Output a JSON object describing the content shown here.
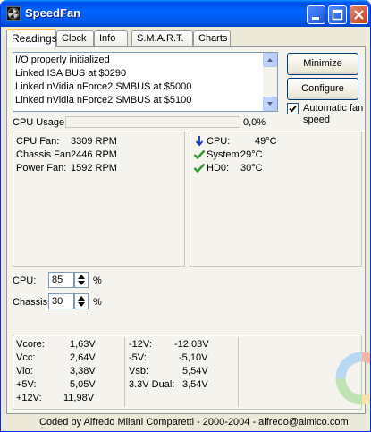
{
  "window": {
    "title": "SpeedFan"
  },
  "tabs": [
    {
      "label": "Readings",
      "active": true
    },
    {
      "label": "Clock",
      "active": false
    },
    {
      "label": "Info",
      "active": false
    },
    {
      "label": "S.M.A.R.T.",
      "active": false
    },
    {
      "label": "Charts",
      "active": false
    }
  ],
  "log": {
    "lines": [
      "I/O properly initialized",
      "Linked ISA BUS at $0290",
      "Linked nVidia nForce2 SMBUS at $5000",
      "Linked nVidia nForce2 SMBUS at $5100"
    ]
  },
  "buttons": {
    "minimize": "Minimize",
    "configure": "Configure"
  },
  "auto_fan": {
    "label": "Automatic fan speed",
    "checked": true
  },
  "cpu_usage": {
    "label": "CPU Usage",
    "value": "0,0%",
    "fraction": 0.0
  },
  "fans": [
    {
      "label": "CPU Fan:",
      "value": "3309 RPM"
    },
    {
      "label": "Chassis Fan:",
      "value": "2446 RPM"
    },
    {
      "label": "Power Fan:",
      "value": "1592 RPM"
    }
  ],
  "temps": [
    {
      "label": "CPU:",
      "value": "49°C",
      "icon": "arrow-down-icon"
    },
    {
      "label": "System:",
      "value": "29°C",
      "icon": "checkmark-icon"
    },
    {
      "label": "HD0:",
      "value": "30°C",
      "icon": "checkmark-icon"
    }
  ],
  "speeds": [
    {
      "label": "CPU:",
      "value": "85",
      "unit": "%"
    },
    {
      "label": "Chassis:",
      "value": "30",
      "unit": "%"
    }
  ],
  "voltages_left": [
    {
      "label": "Vcore:",
      "value": "1,63V"
    },
    {
      "label": "Vcc:",
      "value": "2,64V"
    },
    {
      "label": "Vio:",
      "value": "3,38V"
    },
    {
      "label": "+5V:",
      "value": "5,05V"
    },
    {
      "label": "+12V:",
      "value": "11,98V"
    }
  ],
  "voltages_right": [
    {
      "label": "-12V:",
      "value": "-12,03V"
    },
    {
      "label": "-5V:",
      "value": "-5,10V"
    },
    {
      "label": "Vsb:",
      "value": "5,54V"
    },
    {
      "label": "3.3V Dual:",
      "value": "3,54V"
    }
  ],
  "status": {
    "text": "Coded by Alfredo Milani Comparetti - 2000-2004 - alfredo@almico.com"
  },
  "colors": {
    "accent": "#0055e5",
    "check_green": "#2f9a2f",
    "arrow_blue": "#1e3fbf"
  }
}
